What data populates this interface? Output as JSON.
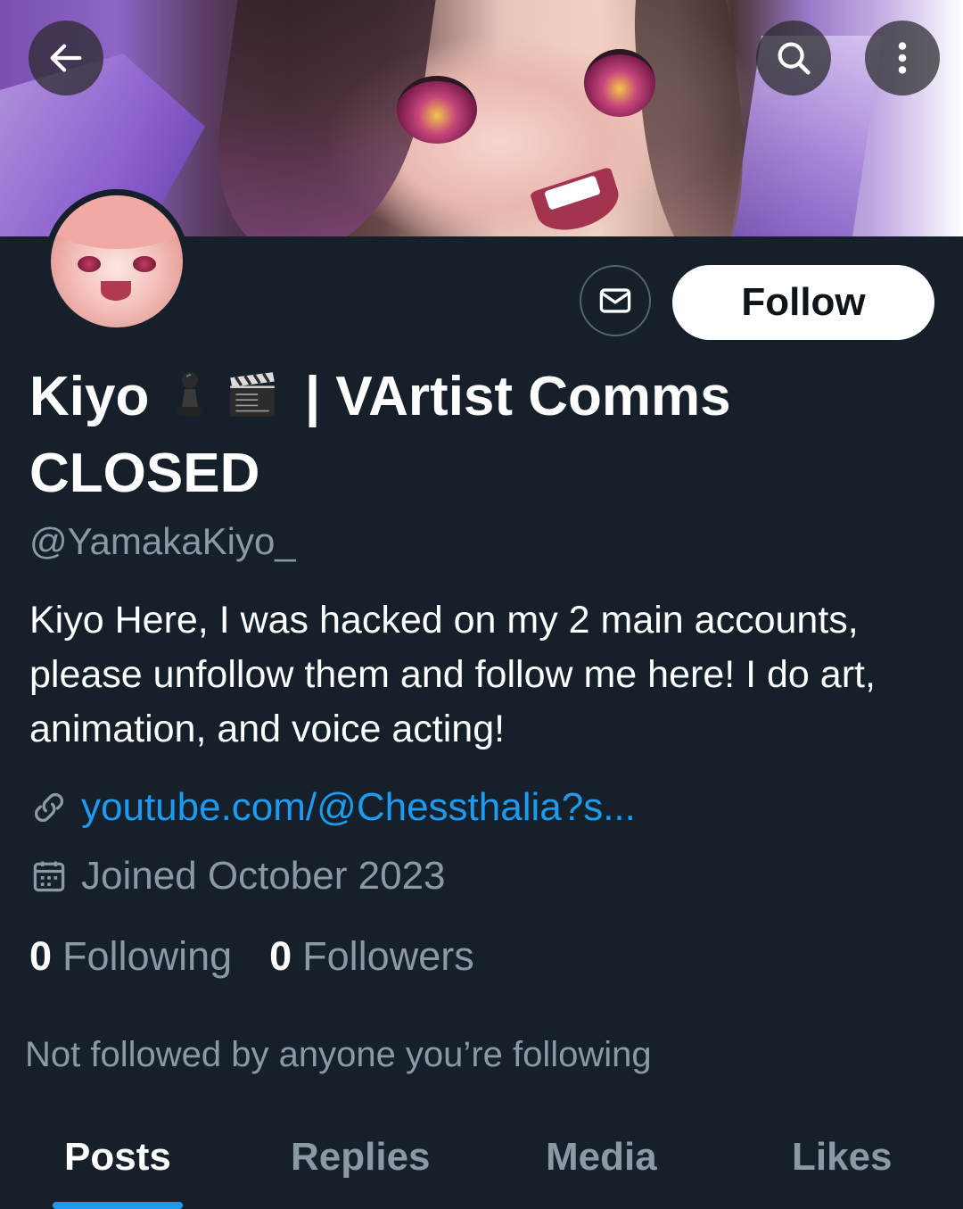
{
  "header": {
    "back_icon": "arrow-left-icon",
    "search_icon": "search-icon",
    "more_icon": "more-vertical-icon"
  },
  "profile": {
    "name_part1": "Kiyo",
    "name_emoji1": "chess-pawn-emoji",
    "name_emoji2": "clapper-board-emoji",
    "name_part2": "| VArtist Comms CLOSED",
    "handle": "@YamakaKiyo_",
    "bio": "Kiyo Here, I was hacked on my 2 main accounts, please unfollow them and follow me here! I do art, animation, and voice acting!",
    "link": "youtube.com/@Chessthalia?s...",
    "joined": "Joined October 2023",
    "following_count": "0",
    "following_label": "Following",
    "followers_count": "0",
    "followers_label": "Followers",
    "not_followed": "Not followed by anyone you’re following"
  },
  "actions": {
    "message_icon": "envelope-icon",
    "follow_label": "Follow"
  },
  "tabs": [
    {
      "label": "Posts",
      "active": true
    },
    {
      "label": "Replies",
      "active": false
    },
    {
      "label": "Media",
      "active": false
    },
    {
      "label": "Likes",
      "active": false
    }
  ],
  "colors": {
    "background": "#15202b",
    "accent": "#1d9bf0",
    "secondary_text": "#8b98a5"
  }
}
